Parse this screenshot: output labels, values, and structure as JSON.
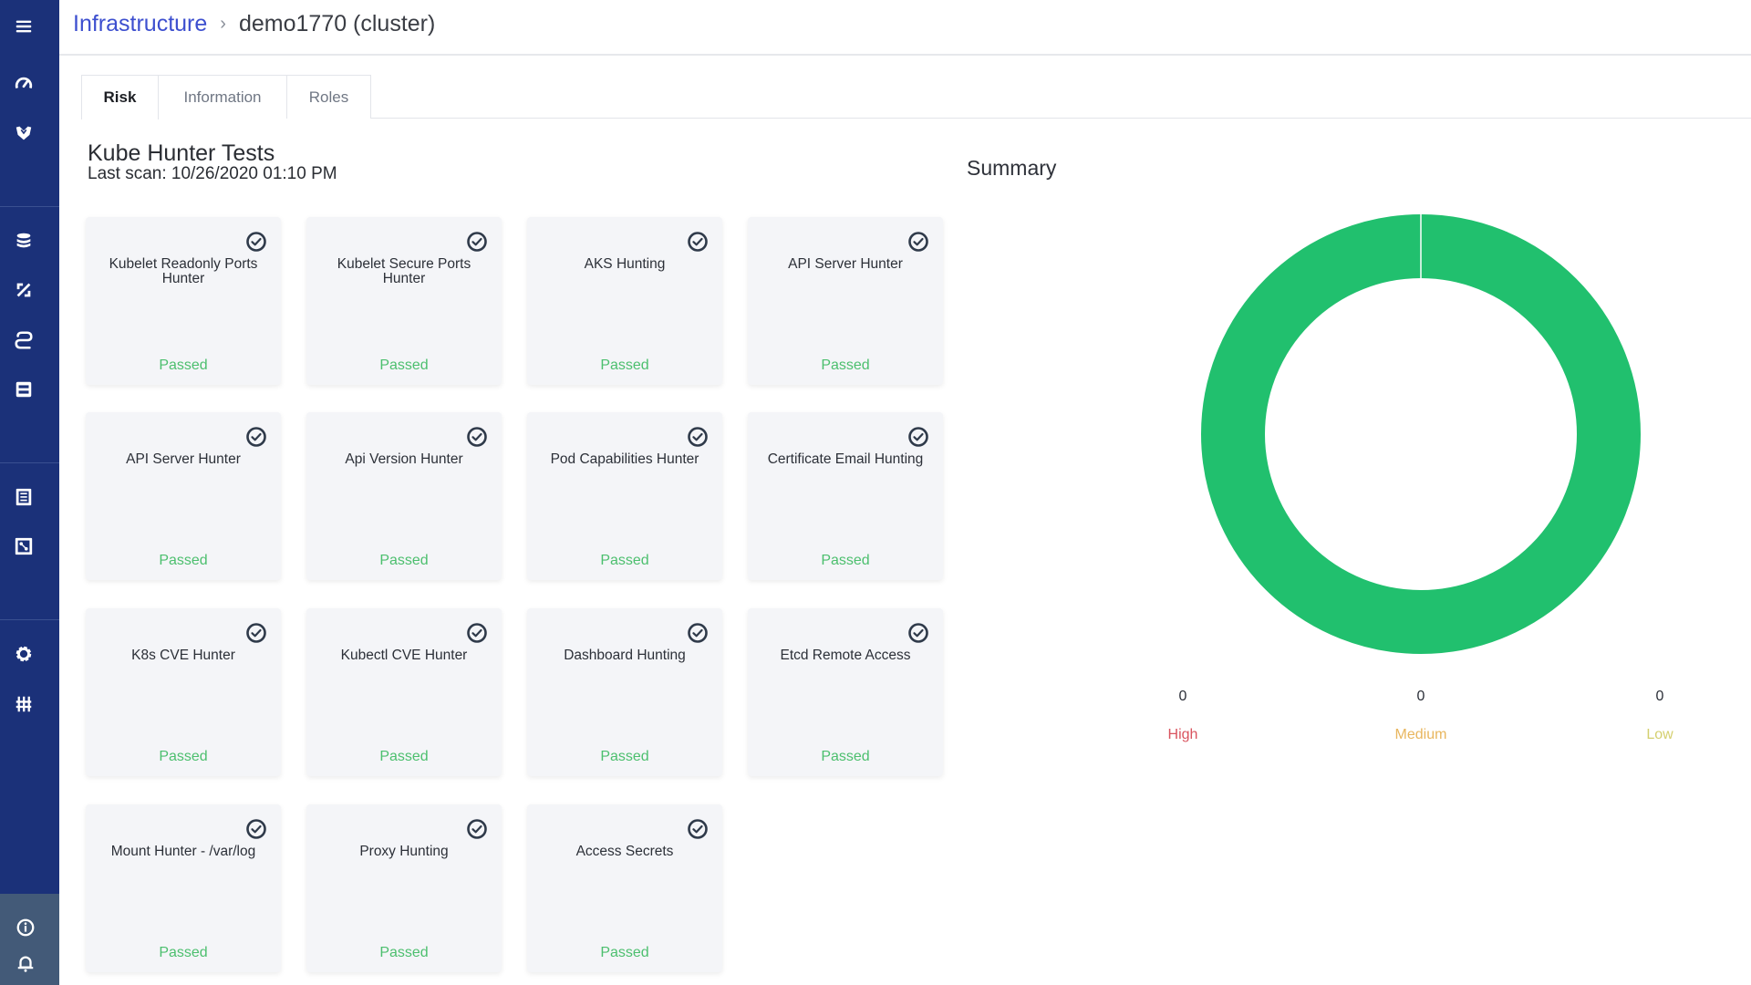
{
  "sidebar": {
    "items": [
      {
        "icon": "menu-icon"
      },
      {
        "icon": "dashboard-gauge-icon"
      },
      {
        "icon": "shield-icon"
      },
      {
        "icon": "layers-icon"
      },
      {
        "icon": "percent-icon"
      },
      {
        "icon": "connection-icon"
      },
      {
        "icon": "server-icon"
      },
      {
        "icon": "document-icon"
      },
      {
        "icon": "graph-icon"
      },
      {
        "icon": "settings-icon"
      },
      {
        "icon": "sliders-icon"
      },
      {
        "icon": "info-icon"
      },
      {
        "icon": "bell-icon"
      }
    ]
  },
  "breadcrumb": {
    "parent": "Infrastructure",
    "separator": "›",
    "current": "demo1770 (cluster)"
  },
  "tabs": [
    {
      "label": "Risk",
      "active": true
    },
    {
      "label": "Information",
      "active": false
    },
    {
      "label": "Roles",
      "active": false
    }
  ],
  "tests": {
    "title": "Kube Hunter Tests",
    "last_scan": "Last scan: 10/26/2020 01:10 PM",
    "cards": [
      {
        "name": "Kubelet Readonly Ports Hunter",
        "status": "Passed"
      },
      {
        "name": "Kubelet Secure Ports Hunter",
        "status": "Passed"
      },
      {
        "name": "AKS Hunting",
        "status": "Passed"
      },
      {
        "name": "API Server Hunter",
        "status": "Passed"
      },
      {
        "name": "API Server Hunter",
        "status": "Passed"
      },
      {
        "name": "Api Version Hunter",
        "status": "Passed"
      },
      {
        "name": "Pod Capabilities Hunter",
        "status": "Passed"
      },
      {
        "name": "Certificate Email Hunting",
        "status": "Passed"
      },
      {
        "name": "K8s CVE Hunter",
        "status": "Passed"
      },
      {
        "name": "Kubectl CVE Hunter",
        "status": "Passed"
      },
      {
        "name": "Dashboard Hunting",
        "status": "Passed"
      },
      {
        "name": "Etcd Remote Access",
        "status": "Passed"
      },
      {
        "name": "Mount Hunter - /var/log",
        "status": "Passed"
      },
      {
        "name": "Proxy Hunting",
        "status": "Passed"
      },
      {
        "name": "Access Secrets",
        "status": "Passed"
      }
    ]
  },
  "summary": {
    "title": "Summary"
  },
  "colors": {
    "passed": "#21c06e",
    "high": "#d9545f",
    "medium": "#e8b65e",
    "low": "#d4cf6e"
  },
  "chart_data": {
    "type": "pie",
    "title": "Summary",
    "donut": true,
    "slices": [
      {
        "label": "Passed",
        "value": 15,
        "color": "#21c06e"
      }
    ],
    "legend": [
      {
        "label": "High",
        "value": 0,
        "color": "#d9545f"
      },
      {
        "label": "Medium",
        "value": 0,
        "color": "#e8b65e"
      },
      {
        "label": "Low",
        "value": 0,
        "color": "#d4cf6e"
      }
    ]
  }
}
